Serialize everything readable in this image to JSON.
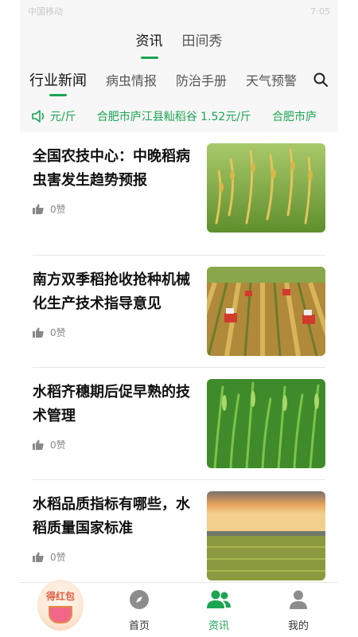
{
  "status_bar": {
    "left": "中国移动",
    "right": "7:05"
  },
  "main_tabs": [
    {
      "label": "资讯",
      "active": true
    },
    {
      "label": "田间秀",
      "active": false
    }
  ],
  "sub_tabs": [
    {
      "label": "行业新闻",
      "active": true
    },
    {
      "label": "病虫情报",
      "active": false
    },
    {
      "label": "防治手册",
      "active": false
    },
    {
      "label": "天气预警",
      "active": false
    }
  ],
  "ticker": {
    "items": [
      "元/斤",
      "合肥市庐江县籼稻谷 1.52元/斤",
      "合肥市庐"
    ]
  },
  "news": [
    {
      "title": "全国农技中心：中晚稻病虫害发生趋势预报",
      "likes": "0赞",
      "image": "rice-closeup"
    },
    {
      "title": "南方双季稻抢收抢种机械化生产技术指导意见",
      "likes": "0赞",
      "image": "harvesters-field"
    },
    {
      "title": "水稻齐穗期后促早熟的技术管理",
      "likes": "0赞",
      "image": "green-rice-ears"
    },
    {
      "title": "水稻品质指标有哪些，水稻质量国家标准",
      "likes": "0赞",
      "image": "sunset-paddy"
    }
  ],
  "red_packet": {
    "label": "得红包"
  },
  "bottom_nav": [
    {
      "label": "首页",
      "icon": "compass-icon",
      "active": false
    },
    {
      "label": "资讯",
      "icon": "people-icon",
      "active": true
    },
    {
      "label": "我的",
      "icon": "person-icon",
      "active": false
    }
  ],
  "colors": {
    "accent": "#1aa552",
    "header_bg": "#f7f7f7"
  }
}
